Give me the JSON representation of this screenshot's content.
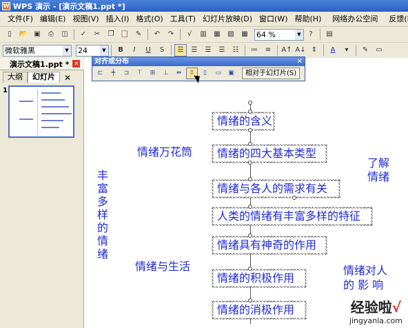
{
  "window": {
    "title": "WPS 演示 - [演示文稿1.ppt *]",
    "logo": "W"
  },
  "menu": [
    "文件(F)",
    "编辑(E)",
    "视图(V)",
    "插入(I)",
    "格式(O)",
    "工具(T)",
    "幻灯片放映(D)",
    "窗口(W)",
    "帮助(H)",
    "网络办公空间",
    "反馈(B)"
  ],
  "toolbar": {
    "zoom": "64 %"
  },
  "format": {
    "font": "微软雅黑",
    "size": "24",
    "bold": "B",
    "italic": "I",
    "underline": "U",
    "strike": "S"
  },
  "doc_tab": "演示文稿1.ppt *",
  "pane_tabs": [
    "大纲",
    "幻灯片"
  ],
  "slide_number": "1",
  "align_panel": {
    "title": "对齐或分布",
    "relative_button": "相对于幻灯片(S)"
  },
  "slide": {
    "vertical_text": "丰富多样的情绪",
    "label_wanhuatong": "情绪万花筒",
    "label_shenghuo": "情绪与生活",
    "label_liaojie": "了解\n情绪",
    "label_yingxiang": "情绪对人\n的 影 响",
    "boxes": [
      "情绪的含义",
      "情绪的四大基本类型",
      "情绪与各人的需求有关",
      "人类的情绪有丰富多样的特征",
      "情绪具有神奇的作用",
      "情绪的积极作用",
      "情绪的消极作用"
    ]
  },
  "watermark": {
    "text": "经验啦",
    "check": "√",
    "url": "jingyanla.com"
  },
  "colors": {
    "slide_text": "#1f2bd4",
    "title_bar": "#2a5fc4"
  }
}
